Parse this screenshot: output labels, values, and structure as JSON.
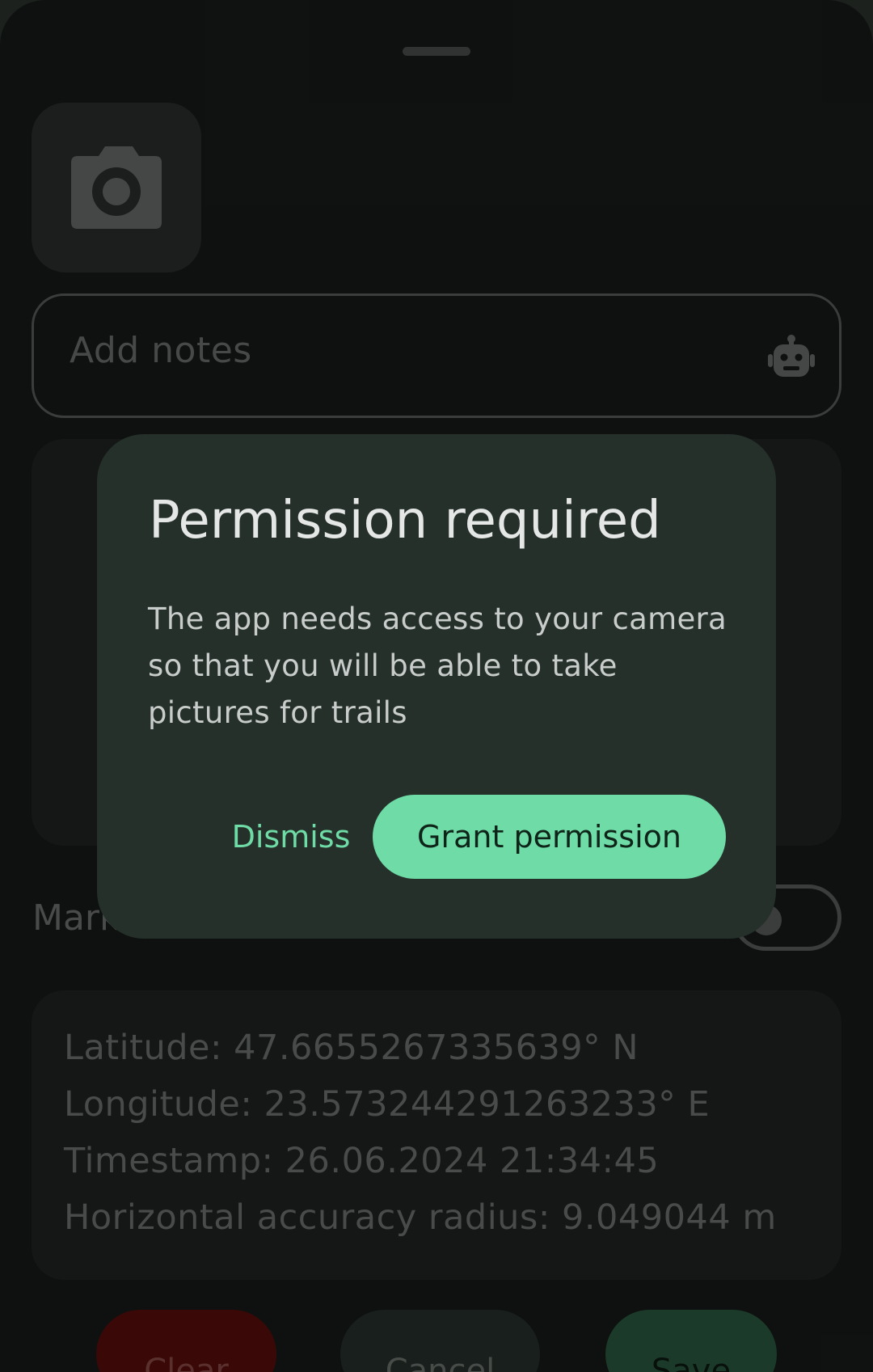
{
  "form": {
    "notes_placeholder": "Add notes",
    "mark_label": "Mark",
    "location": {
      "latitude": "Latitude: 47.6655267335639° N",
      "longitude": "Longitude: 23.573244291263233° E",
      "timestamp": "Timestamp: 26.06.2024 21:34:45",
      "accuracy": "Horizontal accuracy radius: 9.049044 m"
    },
    "actions": {
      "clear_label": "Clear",
      "cancel_label": "Cancel",
      "save_label": "Save"
    },
    "toggle_on": false
  },
  "dialog": {
    "title": "Permission required",
    "body": "The app needs access to your camera so that you will be able to take pictures for trails",
    "dismiss_label": "Dismiss",
    "grant_label": "Grant permission"
  },
  "icons": {
    "photo": "camera-icon",
    "notes_action": "robot-icon"
  },
  "colors": {
    "accent": "#6fdba6",
    "dialog_surface": "#243029",
    "clear": "#5a0f0c",
    "save": "#2a5a40"
  }
}
